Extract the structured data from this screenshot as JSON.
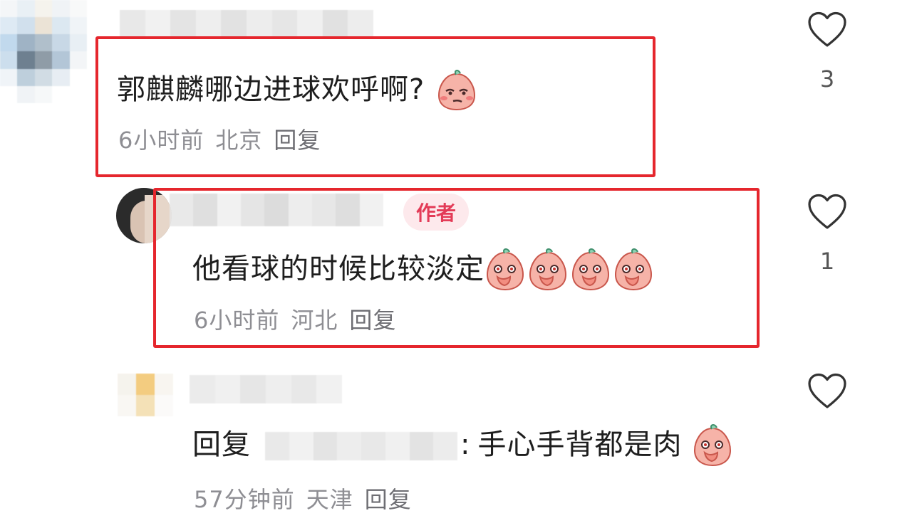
{
  "comments": [
    {
      "text": "郭麒麟哪边进球欢呼啊?",
      "time": "6小时前",
      "location": "北京",
      "reply_label": "回复",
      "likes": "3",
      "emoji": "smirk-peach-emoji"
    },
    {
      "author_badge": "作者",
      "text": "他看球的时候比较淡定",
      "time": "6小时前",
      "location": "河北",
      "reply_label": "回复",
      "likes": "1",
      "emoji": "cover-mouth-peach-emoji"
    },
    {
      "reply_prefix": "回复",
      "reply_separator": ":",
      "text": "手心手背都是肉",
      "time": "57分钟前",
      "location": "天津",
      "reply_label": "回复",
      "emoji": "cover-mouth-peach-emoji"
    }
  ],
  "colors": {
    "highlight_border": "#e5262d",
    "badge_bg": "#fde9ec",
    "badge_text": "#e33b57",
    "meta_text": "#8e8e93"
  },
  "icons": {
    "like": "heart-outline-icon"
  }
}
